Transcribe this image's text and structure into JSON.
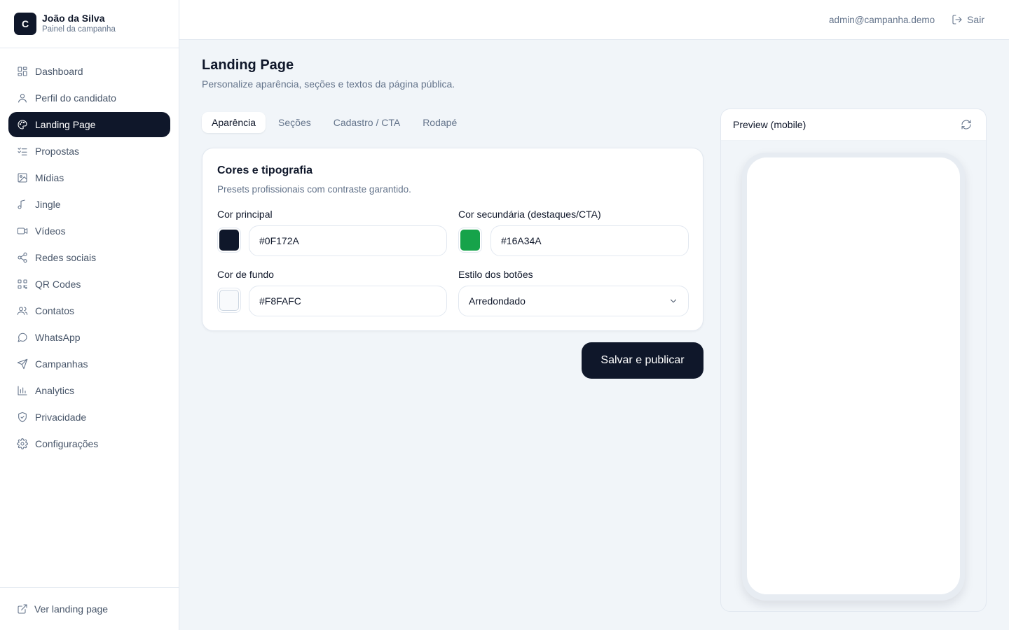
{
  "brand": {
    "logo_letter": "C",
    "name": "João da Silva",
    "subtitle": "Painel da campanha"
  },
  "sidebar": {
    "items": [
      {
        "label": "Dashboard",
        "icon": "dashboard-icon"
      },
      {
        "label": "Perfil do candidato",
        "icon": "user-icon"
      },
      {
        "label": "Landing Page",
        "icon": "palette-icon",
        "active": true
      },
      {
        "label": "Propostas",
        "icon": "list-checks-icon"
      },
      {
        "label": "Mídias",
        "icon": "image-icon"
      },
      {
        "label": "Jingle",
        "icon": "music-icon"
      },
      {
        "label": "Vídeos",
        "icon": "video-icon"
      },
      {
        "label": "Redes sociais",
        "icon": "share-icon"
      },
      {
        "label": "QR Codes",
        "icon": "qr-code-icon"
      },
      {
        "label": "Contatos",
        "icon": "users-icon"
      },
      {
        "label": "WhatsApp",
        "icon": "message-circle-icon"
      },
      {
        "label": "Campanhas",
        "icon": "send-icon"
      },
      {
        "label": "Analytics",
        "icon": "bar-chart-icon"
      },
      {
        "label": "Privacidade",
        "icon": "shield-icon"
      },
      {
        "label": "Configurações",
        "icon": "gear-icon"
      }
    ],
    "footer_link": "Ver landing page"
  },
  "topbar": {
    "email": "admin@campanha.demo",
    "logout_label": "Sair"
  },
  "page": {
    "title": "Landing Page",
    "subtitle": "Personalize aparência, seções e textos da página pública."
  },
  "tabs": [
    {
      "label": "Aparência",
      "active": true
    },
    {
      "label": "Seções"
    },
    {
      "label": "Cadastro / CTA"
    },
    {
      "label": "Rodapé"
    }
  ],
  "card": {
    "title": "Cores e tipografia",
    "subtitle": "Presets profissionais com contraste garantido.",
    "primary": {
      "label": "Cor principal",
      "value": "#0F172A",
      "color": "#0F172A"
    },
    "secondary": {
      "label": "Cor secundária (destaques/CTA)",
      "value": "#16A34A",
      "color": "#16A34A"
    },
    "background": {
      "label": "Cor de fundo",
      "value": "#F8FAFC",
      "color": "#F8FAFC"
    },
    "button_style": {
      "label": "Estilo dos botões",
      "value": "Arredondado"
    }
  },
  "actions": {
    "save_label": "Salvar e publicar"
  },
  "preview": {
    "title": "Preview (mobile)"
  }
}
